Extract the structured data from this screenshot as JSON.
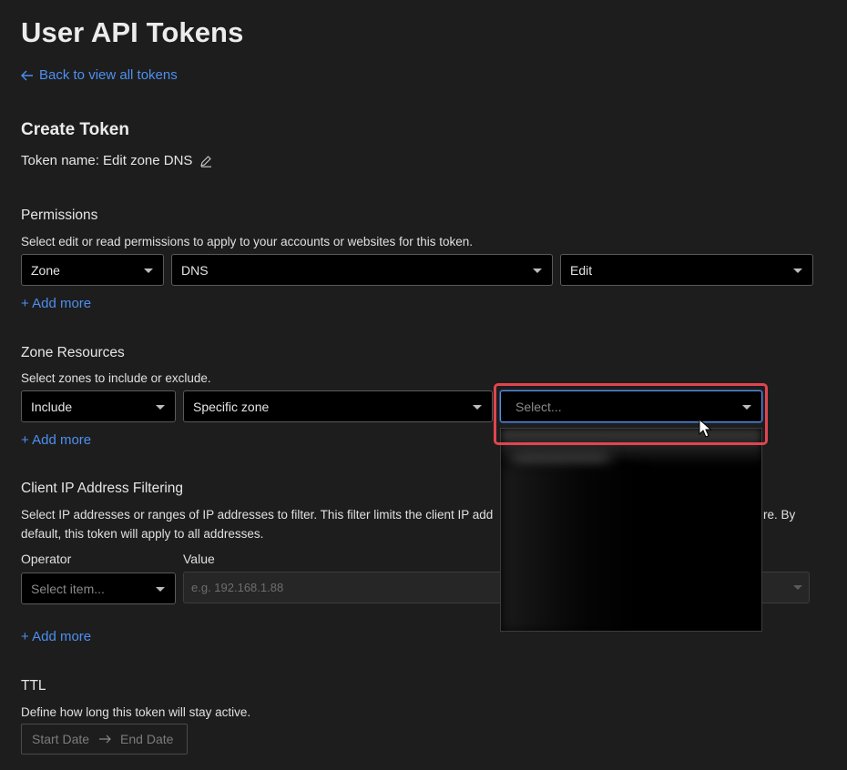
{
  "header": {
    "title": "User API Tokens",
    "back_link": "Back to view all tokens"
  },
  "create": {
    "title": "Create Token",
    "token_name": "Token name: Edit zone DNS"
  },
  "permissions": {
    "title": "Permissions",
    "description": "Select edit or read permissions to apply to your accounts or websites for this token.",
    "selects": [
      "Zone",
      "DNS",
      "Edit"
    ],
    "add_more": "+ Add more"
  },
  "zone_resources": {
    "title": "Zone Resources",
    "description": "Select zones to include or exclude.",
    "selects": [
      "Include",
      "Specific zone"
    ],
    "zone_placeholder": "Select...",
    "add_more": "+ Add more"
  },
  "ip_filtering": {
    "title": "Client IP Address Filtering",
    "description_line1_left": "Select IP addresses or ranges of IP addresses to filter. This filter limits the client IP add",
    "description_line1_right": "re. By",
    "description_line2": "default, this token will apply to all addresses.",
    "operator_label": "Operator",
    "value_label": "Value",
    "operator_placeholder": "Select item...",
    "value_placeholder": "e.g. 192.168.1.88",
    "add_more": "+ Add more"
  },
  "ttl": {
    "title": "TTL",
    "description": "Define how long this token will stay active.",
    "start_date": "Start Date",
    "end_date": "End Date"
  },
  "colors": {
    "accent": "#4d8ff0",
    "highlight": "#e0454f",
    "background": "#1d1d1d"
  }
}
